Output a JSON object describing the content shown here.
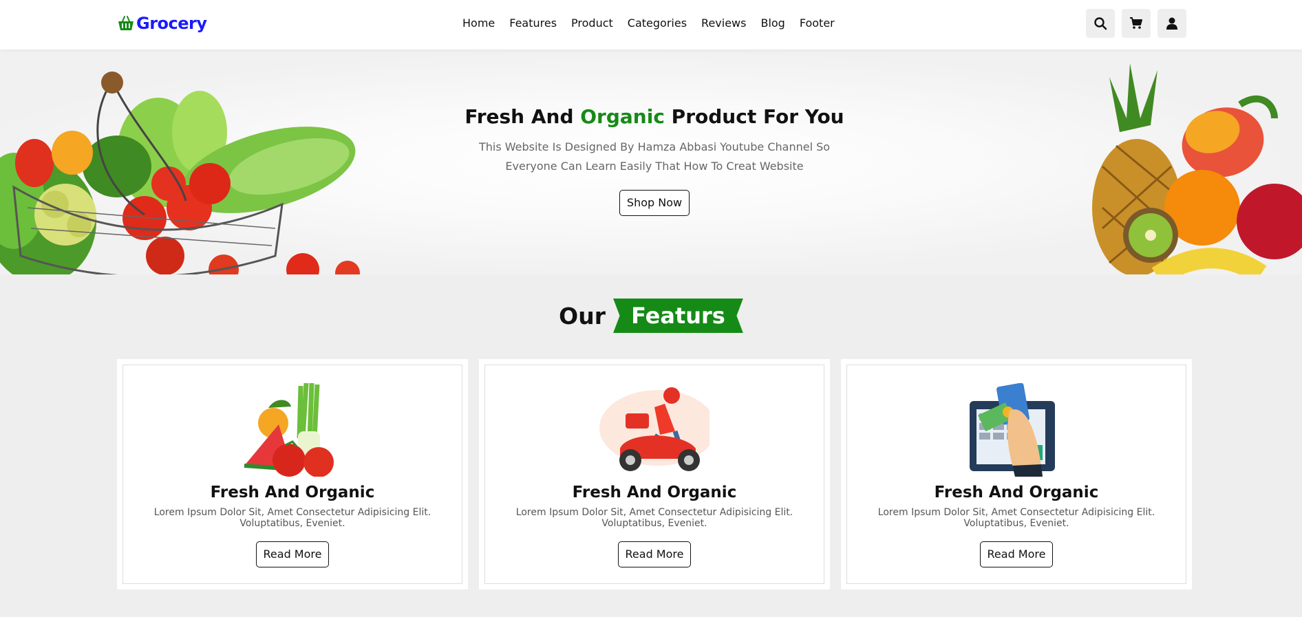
{
  "brand": {
    "name": "Grocery",
    "color": "#1a1aff",
    "icon": "basket-icon"
  },
  "nav": {
    "items": [
      "Home",
      "Features",
      "Product",
      "Categories",
      "Reviews",
      "Blog",
      "Footer"
    ]
  },
  "header_icons": [
    "search-icon",
    "cart-icon",
    "user-icon"
  ],
  "hero": {
    "title_before": "Fresh And ",
    "title_accent": "Organic",
    "title_after": " Product For You",
    "text": "This Website Is Designed By Hamza Abbasi Youtube Channel So Everyone Can Learn Easily That How To Creat Website",
    "button": "Shop Now",
    "accent_color": "#168a16"
  },
  "features": {
    "heading_plain": "Our",
    "heading_tag": "Featurs",
    "cards": [
      {
        "image": "vegetables-illustration",
        "title": "Fresh And Organic",
        "text": "Lorem Ipsum Dolor Sit, Amet Consectetur Adipisicing Elit. Voluptatibus, Eveniet.",
        "button": "Read More"
      },
      {
        "image": "delivery-scooter-illustration",
        "title": "Fresh And Organic",
        "text": "Lorem Ipsum Dolor Sit, Amet Consectetur Adipisicing Elit. Voluptatibus, Eveniet.",
        "button": "Read More"
      },
      {
        "image": "card-payment-illustration",
        "title": "Fresh And Organic",
        "text": "Lorem Ipsum Dolor Sit, Amet Consectetur Adipisicing Elit. Voluptatibus, Eveniet.",
        "button": "Read More"
      }
    ]
  }
}
